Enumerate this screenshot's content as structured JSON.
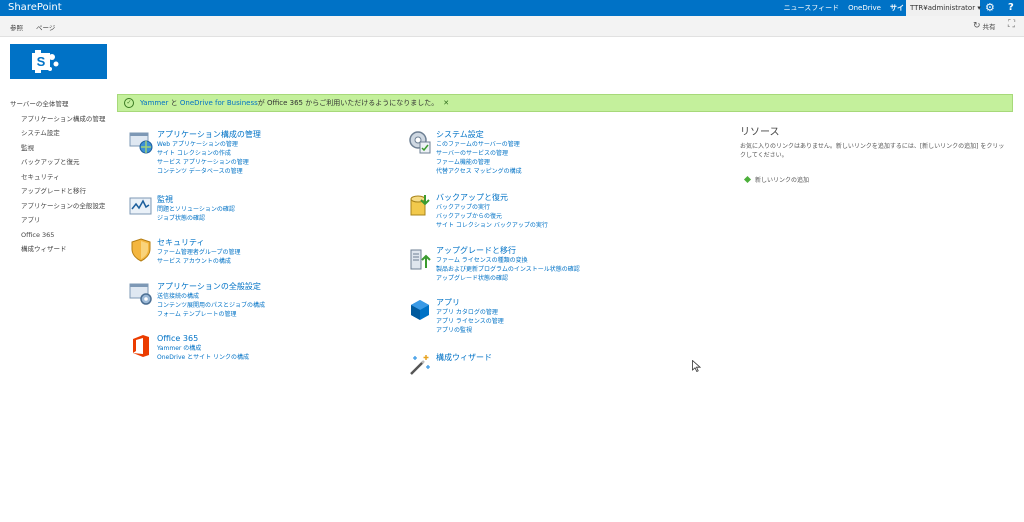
{
  "suitebar": {
    "brand": "SharePoint",
    "links": [
      "ニュースフィード",
      "OneDrive",
      "サイト"
    ],
    "user": "TTR¥administrator ▾",
    "settings_icon": "gear-icon",
    "help_label": "?"
  },
  "ribbon": {
    "tabs": [
      "参照",
      "ページ"
    ],
    "share": "共有",
    "focus_icon": "focus-on-content-icon"
  },
  "quick_launch": {
    "root": "サーバーの全体管理",
    "items": [
      "アプリケーション構成の管理",
      "システム設定",
      "監視",
      "バックアップと復元",
      "セキュリティ",
      "アップグレードと移行",
      "アプリケーションの全般設定",
      "アプリ",
      "Office 365",
      "構成ウィザード"
    ]
  },
  "banner": {
    "link_yammer": "Yammer",
    "text_and": " と ",
    "link_onedrive": "OneDrive for Business",
    "text_rest": " が Office 365 からご利用いただけるようになりました。",
    "close": "✕"
  },
  "sections": {
    "app_management": {
      "title": "アプリケーション構成の管理",
      "links": [
        "Web アプリケーションの管理",
        "サイト コレクションの作成",
        "サービス アプリケーションの管理",
        "コンテンツ データベースの管理"
      ]
    },
    "system_settings": {
      "title": "システム設定",
      "links": [
        "このファームのサーバーの管理",
        "サーバーのサービスの管理",
        "ファーム機能の管理",
        "代替アクセス マッピングの構成"
      ]
    },
    "monitoring": {
      "title": "監視",
      "links": [
        "問題とソリューションの確認",
        "ジョブ状態の確認"
      ]
    },
    "backup_restore": {
      "title": "バックアップと復元",
      "links": [
        "バックアップの実行",
        "バックアップからの復元",
        "サイト コレクション バックアップの実行"
      ]
    },
    "security": {
      "title": "セキュリティ",
      "links": [
        "ファーム管理者グループの管理",
        "サービス アカウントの構成"
      ]
    },
    "upgrade_migration": {
      "title": "アップグレードと移行",
      "links": [
        "ファーム ライセンスの種類の変換",
        "製品および更新プログラムのインストール状態の確認",
        "アップグレード状態の確認"
      ]
    },
    "general_settings": {
      "title": "アプリケーションの全般設定",
      "links": [
        "送信接続の構成",
        "コンテンツ展開用のパスとジョブの構成",
        "フォーム テンプレートの管理"
      ]
    },
    "apps": {
      "title": "アプリ",
      "links": [
        "アプリ カタログの管理",
        "アプリ ライセンスの管理",
        "アプリの監視"
      ]
    },
    "office365": {
      "title": "Office 365",
      "links": [
        "Yammer の構成",
        "OneDrive とサイト リンクの構成"
      ]
    },
    "wizard": {
      "title": "構成ウィザード",
      "links": []
    }
  },
  "resources": {
    "title": "リソース",
    "empty_text": "お気に入りのリンクはありません。新しいリンクを追加するには、[新しいリンクの追加] をクリックしてください。",
    "add_link": "新しいリンクの追加"
  },
  "colors": {
    "suite_bar": "#0072c6",
    "link": "#0072c6",
    "banner": "#c4f09c",
    "ribbon": "#f3f3f3"
  }
}
